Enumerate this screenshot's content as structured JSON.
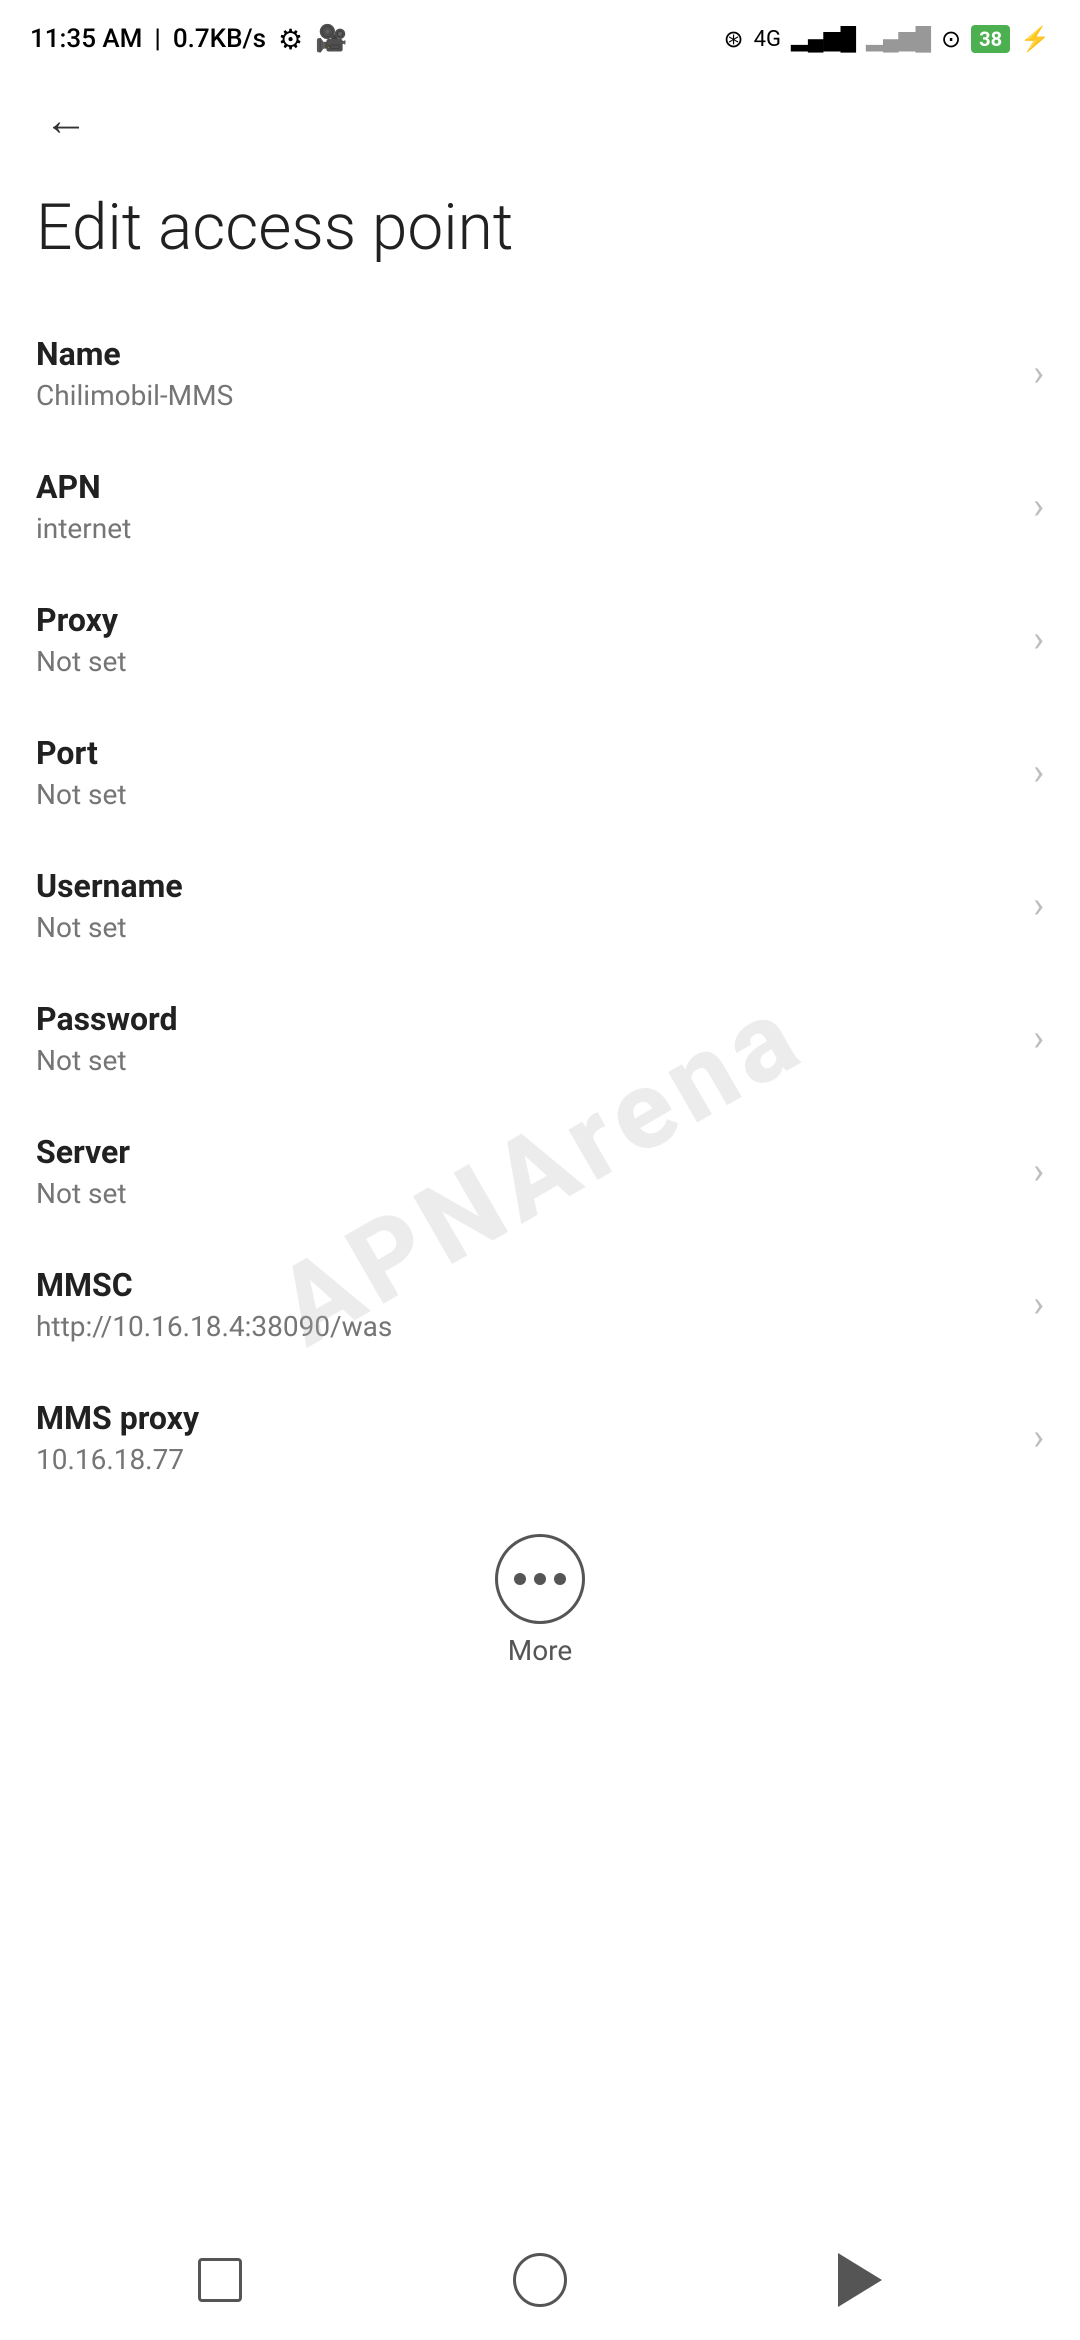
{
  "statusBar": {
    "time": "11:35 AM",
    "speed": "0.7KB/s"
  },
  "nav": {
    "back_label": "←"
  },
  "page": {
    "title": "Edit access point"
  },
  "settings": [
    {
      "id": "name",
      "label": "Name",
      "value": "Chilimobil-MMS"
    },
    {
      "id": "apn",
      "label": "APN",
      "value": "internet"
    },
    {
      "id": "proxy",
      "label": "Proxy",
      "value": "Not set"
    },
    {
      "id": "port",
      "label": "Port",
      "value": "Not set"
    },
    {
      "id": "username",
      "label": "Username",
      "value": "Not set"
    },
    {
      "id": "password",
      "label": "Password",
      "value": "Not set"
    },
    {
      "id": "server",
      "label": "Server",
      "value": "Not set"
    },
    {
      "id": "mmsc",
      "label": "MMSC",
      "value": "http://10.16.18.4:38090/was"
    },
    {
      "id": "mms-proxy",
      "label": "MMS proxy",
      "value": "10.16.18.77"
    }
  ],
  "more": {
    "label": "More"
  },
  "watermark": {
    "text": "APNArena"
  }
}
